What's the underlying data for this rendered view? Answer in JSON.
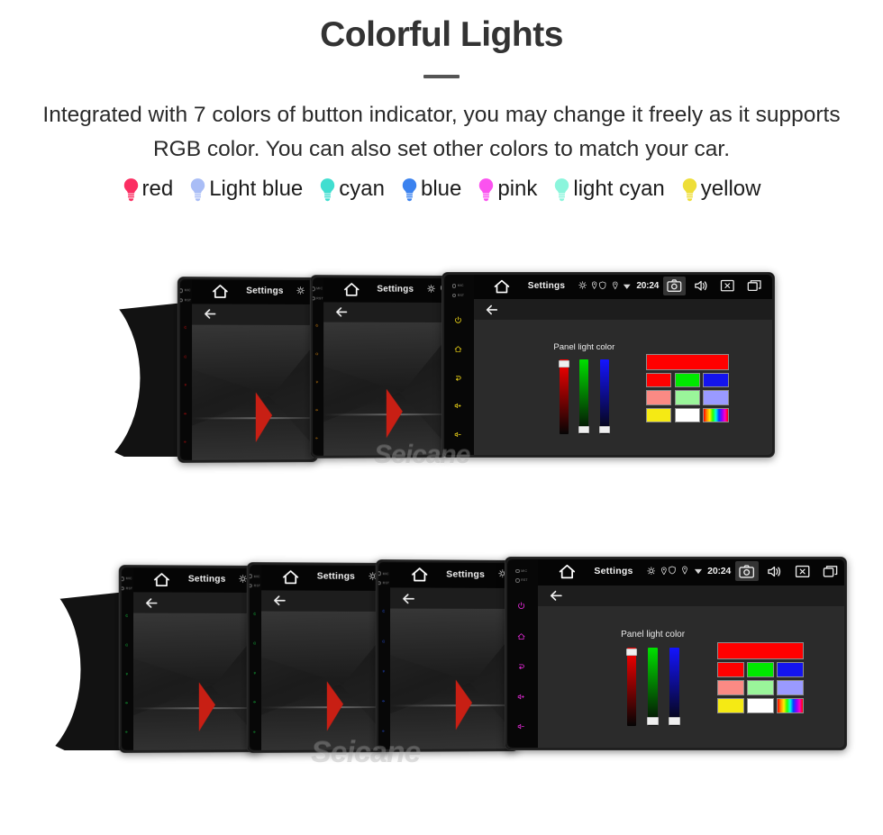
{
  "header": {
    "title": "Colorful Lights",
    "subtitle": "Integrated with 7 colors of button indicator, you may change it freely as it supports RGB color. You can also set other colors to match your car.",
    "title_color": "#333333",
    "divider_color": "#555555"
  },
  "legend": {
    "items": [
      {
        "label": "red",
        "icon": "bulb-icon",
        "color": "#fb2e62"
      },
      {
        "label": "Light blue",
        "icon": "bulb-icon",
        "color": "#a9bdf6"
      },
      {
        "label": "cyan",
        "icon": "bulb-icon",
        "color": "#41ded0"
      },
      {
        "label": "blue",
        "icon": "bulb-icon",
        "color": "#3b82ef"
      },
      {
        "label": "pink",
        "icon": "bulb-icon",
        "color": "#fb52ef"
      },
      {
        "label": "light cyan",
        "icon": "bulb-icon",
        "color": "#8bf5dc"
      },
      {
        "label": "yellow",
        "icon": "bulb-icon",
        "color": "#eede38"
      }
    ]
  },
  "status_bar": {
    "home_icon": "home-icon",
    "title": "Settings",
    "mini_icons": [
      "gear-icon",
      "location-pin-icon"
    ],
    "tray_icons": [
      "shield-icon",
      "location-icon",
      "wifi-icon"
    ],
    "time": "20:24",
    "buttons": [
      {
        "icon": "camera-icon",
        "highlighted": true
      },
      {
        "icon": "volume-icon",
        "highlighted": false
      },
      {
        "icon": "close-box-icon",
        "highlighted": false
      },
      {
        "icon": "recent-apps-icon",
        "highlighted": false
      },
      {
        "icon": "back-arrow-icon",
        "highlighted": false
      }
    ]
  },
  "toolbar": {
    "back_icon": "back-arrow-icon"
  },
  "settings_panel": {
    "caption": "Panel light color",
    "sliders": [
      {
        "name": "red-slider",
        "color": "#ff0000",
        "thumb_position": "top"
      },
      {
        "name": "green-slider",
        "color": "#00e000",
        "thumb_position": "bottom"
      },
      {
        "name": "blue-slider",
        "color": "#1414ff",
        "thumb_position": "bottom"
      }
    ],
    "preview_color": "#ff0000",
    "swatches": [
      {
        "name": "swatch-red",
        "color": "#ff0000"
      },
      {
        "name": "swatch-green",
        "color": "#00e800"
      },
      {
        "name": "swatch-blue",
        "color": "#1414ee"
      },
      {
        "name": "swatch-salmon",
        "color": "#fb8a84"
      },
      {
        "name": "swatch-light-green",
        "color": "#9af59a"
      },
      {
        "name": "swatch-periwinkle",
        "color": "#9a9aff"
      },
      {
        "name": "swatch-yellow",
        "color": "#f5ea14"
      },
      {
        "name": "swatch-white",
        "color": "#ffffff"
      },
      {
        "name": "swatch-rainbow",
        "color": "rainbow"
      }
    ]
  },
  "key_column": {
    "labels": [
      "MIC",
      "RST"
    ],
    "keys": [
      "power-icon",
      "home-icon",
      "back-icon",
      "volume-up-icon",
      "volume-down-icon"
    ]
  },
  "rows": [
    {
      "name": "row-top",
      "units": [
        {
          "name": "unit-red",
          "indicator_color": "#e01010",
          "screen": "wallpaper",
          "size": "small"
        },
        {
          "name": "unit-orange",
          "indicator_color": "#f79a12",
          "screen": "wallpaper",
          "size": "small"
        },
        {
          "name": "unit-yellow",
          "indicator_color": "#f2d817",
          "screen": "settings",
          "size": "large"
        }
      ]
    },
    {
      "name": "row-bottom",
      "units": [
        {
          "name": "unit-green-1",
          "indicator_color": "#19e04a",
          "screen": "wallpaper",
          "size": "small"
        },
        {
          "name": "unit-green-2",
          "indicator_color": "#19e04a",
          "screen": "wallpaper",
          "size": "small"
        },
        {
          "name": "unit-blue",
          "indicator_color": "#2a5bf5",
          "screen": "wallpaper",
          "size": "small"
        },
        {
          "name": "unit-magenta",
          "indicator_color": "#e52ad8",
          "screen": "settings",
          "size": "large"
        }
      ]
    }
  ],
  "watermark": {
    "text": "Seicane"
  }
}
